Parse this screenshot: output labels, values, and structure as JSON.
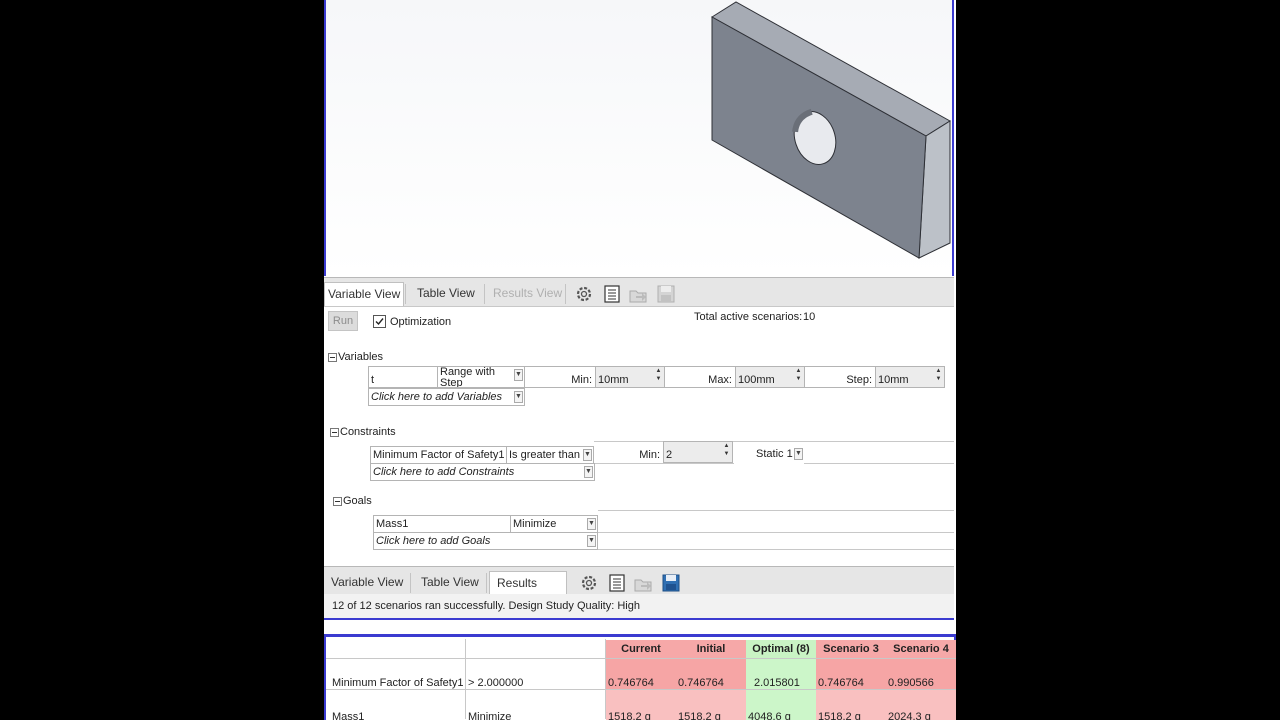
{
  "top_panel": {
    "tabs": [
      {
        "label": "Variable View",
        "state": "active"
      },
      {
        "label": "Table View",
        "state": "normal"
      },
      {
        "label": "Results View",
        "state": "disabled"
      }
    ],
    "toolbar_icons": [
      "gear-icon",
      "list-icon",
      "export-icon",
      "save-icon"
    ],
    "run_label": "Run",
    "optimization_label": "Optimization",
    "optimization_checked": true,
    "total_scenarios_label": "Total active scenarios:",
    "total_scenarios_value": "10"
  },
  "variables": {
    "header": "Variables",
    "row": {
      "name": "t",
      "type": "Range with Step",
      "min_label": "Min:",
      "min_value": "10mm",
      "max_label": "Max:",
      "max_value": "100mm",
      "step_label": "Step:",
      "step_value": "10mm"
    },
    "add_label": "Click here to add Variables"
  },
  "constraints": {
    "header": "Constraints",
    "row": {
      "name": "Minimum Factor of Safety1",
      "condition": "Is greater than",
      "min_label": "Min:",
      "min_value": "2",
      "study": "Static 1"
    },
    "add_label": "Click here to add Constraints"
  },
  "goals": {
    "header": "Goals",
    "row": {
      "name": "Mass1",
      "goal": "Minimize"
    },
    "add_label": "Click here to add Goals"
  },
  "bottom_panel": {
    "tabs": [
      {
        "label": "Variable View",
        "state": "normal"
      },
      {
        "label": "Table View",
        "state": "normal"
      },
      {
        "label": "Results View",
        "state": "active"
      }
    ],
    "toolbar_icons": [
      "gear-icon",
      "list-icon",
      "export-icon",
      "save-icon"
    ],
    "status": "12 of 12 scenarios ran successfully. Design Study Quality: High"
  },
  "results_table": {
    "columns": [
      "Current",
      "Initial",
      "Optimal (8)",
      "Scenario 3",
      "Scenario 4"
    ],
    "rows": [
      {
        "name": "Minimum Factor of Safety1",
        "criterion": "> 2.000000",
        "values": [
          "0.746764",
          "0.746764",
          "2.015801",
          "0.746764",
          "0.990566"
        ]
      },
      {
        "name": "Mass1",
        "criterion": "Minimize",
        "values": [
          "1518.2 g",
          "1518.2 g",
          "4048.6 g",
          "1518.2 g",
          "2024.3 g"
        ]
      }
    ]
  },
  "colors": {
    "accent_border": "#3b3bd0",
    "fail_cell": "#f6a5a5",
    "optimal_cell": "#ccf6c9",
    "part_face": "#7f8590"
  }
}
